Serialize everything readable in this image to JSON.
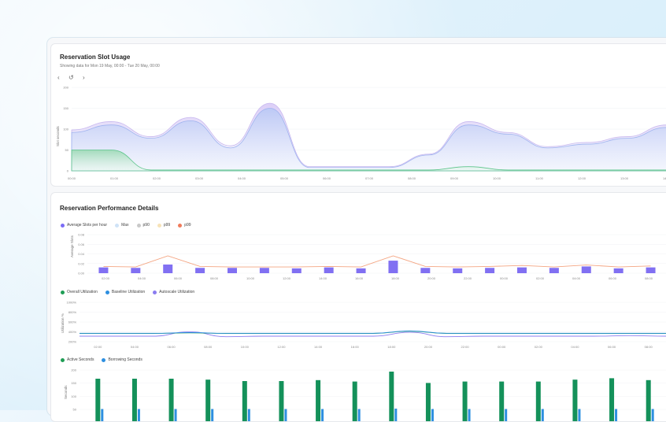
{
  "usage": {
    "title": "Reservation Slot Usage",
    "subtitle": "Showing data for Mon 19 May, 00:00 - Tue 20 May, 00:00",
    "nav": {
      "prev": "‹",
      "reset": "↺",
      "next": "›"
    },
    "ylabel": "Slot seconds",
    "yticks": [
      "200",
      "150",
      "100",
      "50",
      "0"
    ],
    "xticks": [
      "00:00",
      "01:00",
      "02:00",
      "03:00",
      "04:00",
      "05:00",
      "06:00",
      "07:00",
      "08:00",
      "09:00",
      "10:00",
      "11:00",
      "12:00",
      "13:00",
      "14:00"
    ]
  },
  "details": {
    "title": "Reservation Performance Details",
    "legend1": [
      {
        "label": "Average Slots per hour",
        "color": "#7b6cf6"
      },
      {
        "label": "Max",
        "color": "#cfe3f7"
      },
      {
        "label": "p90",
        "color": "#c9c9c9"
      },
      {
        "label": "p99",
        "color": "#f7e3b8"
      },
      {
        "label": "p99",
        "color": "#f07b5a"
      }
    ],
    "legend2": [
      {
        "label": "Overall Utilization",
        "color": "#1f9d55"
      },
      {
        "label": "Baseline Utilization",
        "color": "#2d8fe0"
      },
      {
        "label": "Autoscale Utilization",
        "color": "#8b7cf0"
      }
    ],
    "legend3": [
      {
        "label": "Active Seconds",
        "color": "#1f9d55"
      },
      {
        "label": "Borrowing Seconds",
        "color": "#2d8fe0"
      }
    ],
    "chart1": {
      "ylabel": "Average Slots",
      "yticks": [
        "0.08",
        "0.06",
        "0.04",
        "0.02",
        "0.00"
      ]
    },
    "chart2": {
      "ylabel": "Utilization %",
      "yticks": [
        "1000%",
        "800%",
        "600%",
        "400%",
        "200%"
      ]
    },
    "chart3": {
      "ylabel": "Seconds",
      "yticks": [
        "200",
        "150",
        "100",
        "50"
      ]
    },
    "xticks": [
      "02:00",
      "04:00",
      "06:00",
      "08:00",
      "10:00",
      "12:00",
      "14:00",
      "16:00",
      "18:00",
      "20:00",
      "22:00",
      "00:00",
      "02:00",
      "04:00",
      "06:00",
      "08:00"
    ]
  },
  "chart_data": [
    {
      "type": "area",
      "title": "Reservation Slot Usage",
      "ylabel": "Slot seconds",
      "ylim": [
        0,
        200
      ],
      "series": [
        {
          "name": "Max",
          "values": [
            98,
            118,
            82,
            128,
            60,
            162,
            10,
            10,
            10,
            40,
            118,
            92,
            58,
            68,
            82,
            110
          ]
        },
        {
          "name": "Average",
          "values": [
            92,
            110,
            78,
            120,
            55,
            150,
            8,
            8,
            8,
            38,
            110,
            88,
            55,
            64,
            78,
            104
          ]
        },
        {
          "name": "Baseline",
          "values": [
            50,
            50,
            2,
            2,
            2,
            2,
            2,
            2,
            2,
            2,
            10,
            2,
            2,
            2,
            2,
            2
          ]
        }
      ]
    },
    {
      "type": "bar",
      "ylabel": "Average Slots",
      "ylim": [
        0,
        0.08
      ],
      "series": [
        {
          "name": "Average Slots per hour",
          "values": [
            0.012,
            0.011,
            0.018,
            0.011,
            0.011,
            0.011,
            0.01,
            0.012,
            0.01,
            0.026,
            0.011,
            0.01,
            0.011,
            0.012,
            0.011,
            0.014,
            0.01,
            0.012
          ]
        },
        {
          "name": "p99",
          "values": [
            0.014,
            0.013,
            0.036,
            0.014,
            0.013,
            0.013,
            0.013,
            0.014,
            0.013,
            0.036,
            0.014,
            0.013,
            0.014,
            0.016,
            0.013,
            0.017,
            0.013,
            0.015
          ]
        }
      ]
    },
    {
      "type": "line",
      "ylabel": "Utilization %",
      "ylim": [
        0,
        1000
      ],
      "series": [
        {
          "name": "Overall Utilization",
          "values": [
            300,
            300,
            300,
            320,
            300,
            300,
            300,
            300,
            300,
            380,
            300,
            300,
            300,
            300,
            300,
            300,
            300
          ]
        },
        {
          "name": "Baseline Utilization",
          "values": [
            305,
            305,
            305,
            330,
            305,
            305,
            305,
            305,
            305,
            390,
            305,
            305,
            305,
            305,
            305,
            305,
            305
          ]
        },
        {
          "name": "Autoscale Utilization",
          "values": [
            200,
            200,
            200,
            360,
            180,
            200,
            200,
            200,
            200,
            340,
            180,
            200,
            200,
            200,
            200,
            220,
            200
          ]
        }
      ]
    },
    {
      "type": "bar",
      "ylabel": "Seconds",
      "ylim": [
        0,
        200
      ],
      "series": [
        {
          "name": "Active Seconds",
          "values": [
            130,
            130,
            130,
            126,
            120,
            120,
            124,
            118,
            160,
            112,
            118,
            118,
            118,
            126,
            132,
            124
          ]
        },
        {
          "name": "Borrowing Seconds",
          "values": [
            2,
            2,
            2,
            2,
            2,
            2,
            2,
            2,
            4,
            2,
            2,
            2,
            2,
            2,
            2,
            2
          ]
        }
      ]
    }
  ]
}
